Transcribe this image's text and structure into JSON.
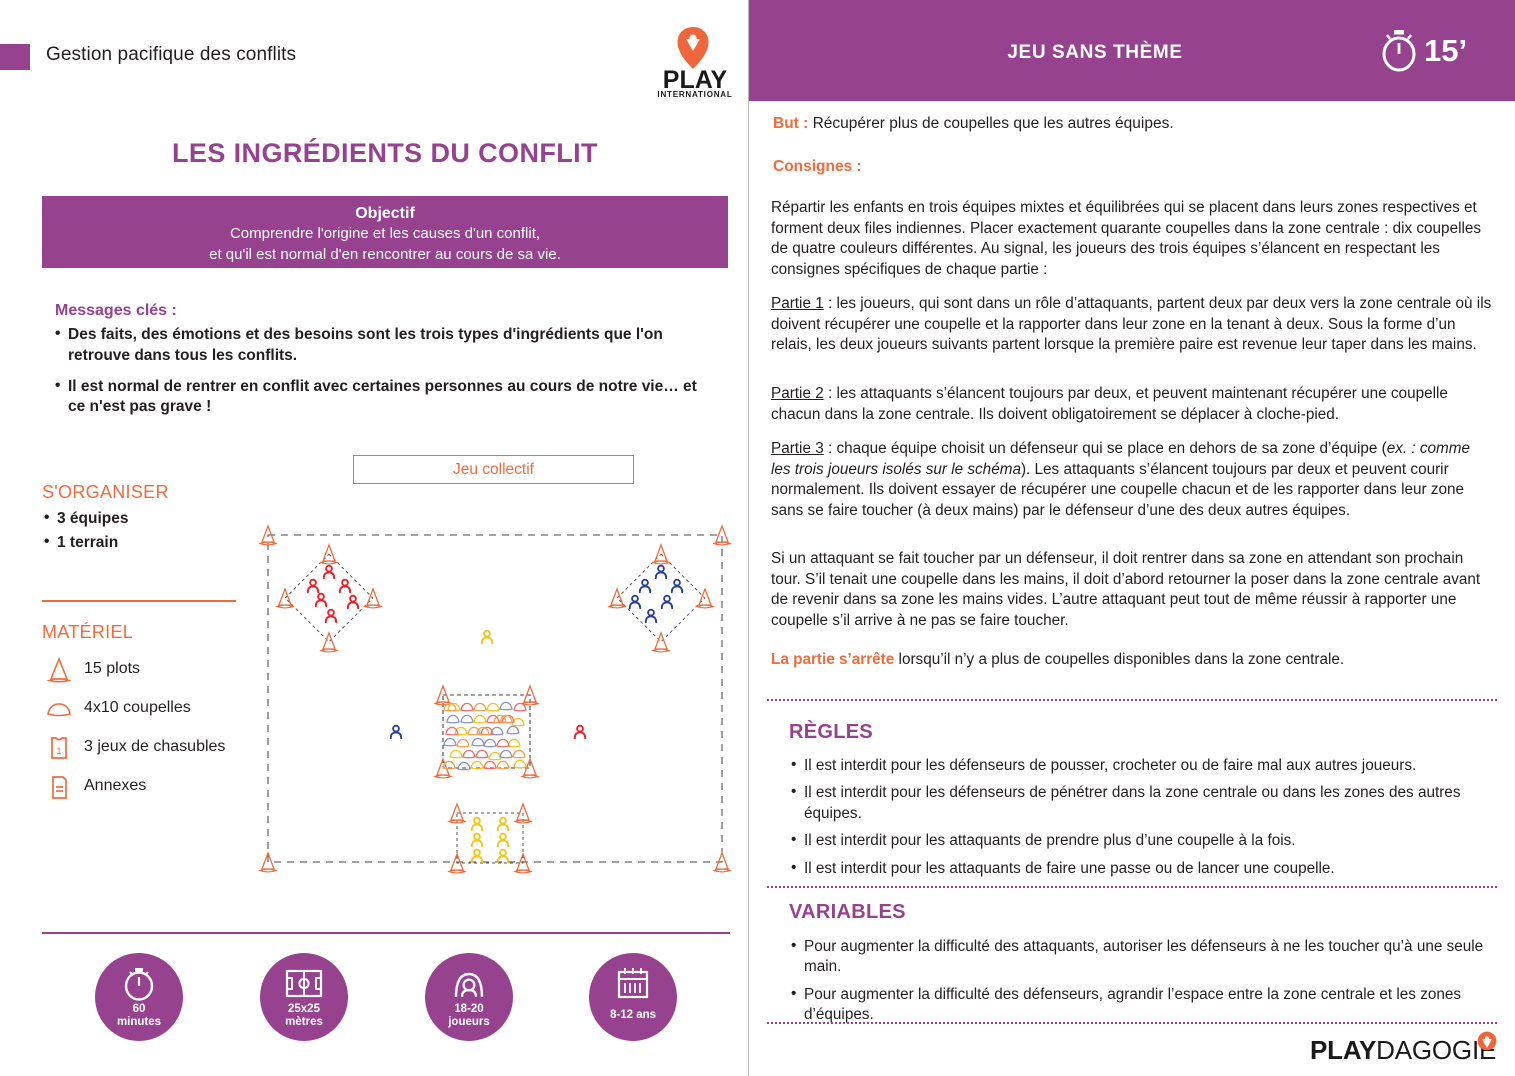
{
  "header": {
    "breadcrumb": "Gestion pacifique des conflits",
    "logo_word": "PLAY",
    "logo_sub": "INTERNATIONAL"
  },
  "sheet": {
    "title": "LES INGRÉDIENTS DU CONFLIT",
    "objectif": {
      "label": "Objectif",
      "line1": "Comprendre l'origine et les causes d'un conflit,",
      "line2": "et qu'il est normal d'en rencontrer au cours de sa vie."
    },
    "messages_cles": {
      "heading": "Messages clés :",
      "items": [
        "Des faits, des émotions et des besoins sont les trois types d'ingrédients que l'on retrouve dans tous les conflits.",
        "Il est normal de rentrer en conflit avec certaines personnes au cours de notre vie… et ce n'est pas grave !"
      ]
    },
    "organiser": {
      "heading": "S'ORGANISER",
      "items": [
        "3 équipes",
        "1 terrain"
      ]
    },
    "materiel": {
      "heading": "MATÉRIEL",
      "items": [
        {
          "icon": "cone-icon",
          "label": "15 plots"
        },
        {
          "icon": "cup-icon",
          "label": "4x10 coupelles"
        },
        {
          "icon": "jersey-icon",
          "label": "3 jeux de chasubles"
        },
        {
          "icon": "document-icon",
          "label": "Annexes"
        }
      ]
    },
    "diagram_label": "Jeu collectif",
    "badges": [
      {
        "icon": "stopwatch-icon",
        "line1": "60",
        "line2": "minutes"
      },
      {
        "icon": "field-icon",
        "line1": "25x25",
        "line2": "mètres"
      },
      {
        "icon": "players-icon",
        "line1": "18-20",
        "line2": "joueurs"
      },
      {
        "icon": "calendar-icon",
        "line1": "8-12 ans",
        "line2": ""
      }
    ]
  },
  "right": {
    "title": "JEU SANS THÈME",
    "duration": "15’",
    "but_label": "But :",
    "but_text": " Récupérer plus de coupelles que les autres équipes.",
    "consignes_label": "Consignes :",
    "intro": "Répartir les enfants en trois équipes mixtes et équilibrées qui se placent dans leurs zones respectives et forment deux files indiennes. Placer exactement quarante coupelles dans la zone centrale : dix coupelles de quatre couleurs différentes. Au signal, les joueurs des trois équipes s’élancent en respectant les consignes spécifiques de chaque partie :",
    "partie1_label": "Partie 1",
    "partie1_text": " : les joueurs, qui sont dans un rôle d’attaquants, partent deux par deux vers la zone centrale où ils doivent récupérer une coupelle et la rapporter dans leur zone en la tenant à deux. Sous la forme d’un relais, les deux joueurs suivants partent lorsque la première paire est revenue leur taper dans les mains.",
    "partie2_label": "Partie 2",
    "partie2_text": " : les attaquants s’élancent toujours par deux, et peuvent maintenant récupérer une coupelle chacun dans la zone centrale. Ils doivent obligatoirement se déplacer à cloche-pied.",
    "partie3_label": "Partie 3",
    "partie3_text_a": " : chaque équipe choisit un défenseur qui se place en dehors de sa zone d’équipe (",
    "partie3_italic": "ex. : comme les trois joueurs isolés sur le schéma",
    "partie3_text_b": "). Les attaquants s’élancent toujours par deux et peuvent courir normalement. Ils doivent essayer de récupérer une coupelle chacun et de les rapporter dans leur zone sans se faire toucher (à deux mains) par le défenseur d’une des deux autres équipes.",
    "touche_para": "Si un attaquant se fait toucher par un défenseur, il doit rentrer dans sa zone en attendant son prochain tour. S’il tenait une coupelle dans les mains, il doit d’abord retourner la poser dans la zone centrale avant de revenir dans sa zone les mains vides. L’autre attaquant peut tout de même réussir à rapporter une coupelle s’il arrive à ne pas se faire toucher.",
    "arret_label": "La partie s’arrête",
    "arret_text": " lorsqu’il n’y a plus de coupelles disponibles dans la zone centrale.",
    "regles": {
      "heading": "RÈGLES",
      "items": [
        "Il est interdit pour les défenseurs de pousser, crocheter ou de faire mal aux autres joueurs.",
        "Il est interdit pour les défenseurs de pénétrer dans la zone centrale ou dans les zones des autres équipes.",
        "Il est interdit pour les attaquants de prendre plus d’une coupelle à la fois.",
        "Il est interdit pour les attaquants de faire une passe ou de lancer une coupelle."
      ]
    },
    "variables": {
      "heading": "VARIABLES",
      "items": [
        "Pour augmenter la difficulté des attaquants, autoriser les défenseurs à ne les toucher qu’à une seule main.",
        "Pour augmenter la difficulté des défenseurs, agrandir l’espace entre la zone centrale et les zones d’équipes."
      ]
    },
    "footer_logo_bold": "PLAY",
    "footer_logo_thin": "DAGOGIE"
  },
  "colors": {
    "purple": "#96428f",
    "orange": "#ef6c3e",
    "red_team": "#e8202a",
    "blue_team": "#2b3f96",
    "yellow_team": "#f5c518",
    "text": "#231f20"
  }
}
